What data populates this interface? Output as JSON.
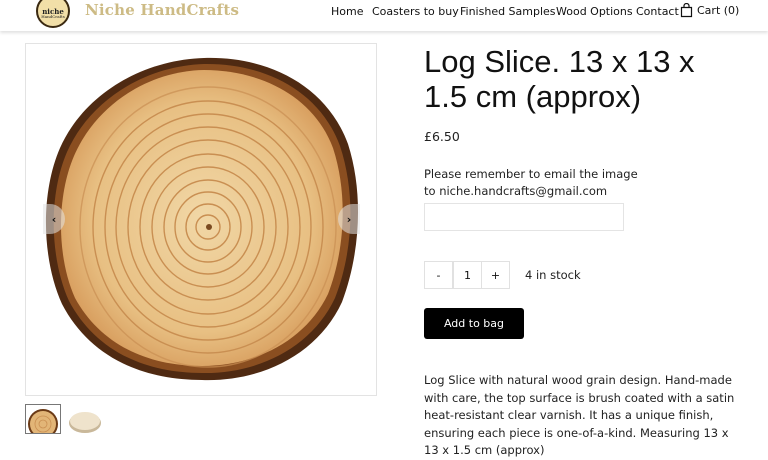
{
  "header": {
    "logo_line1": "niche",
    "logo_line2": "HandCrafts",
    "brand": "Niche HandCrafts",
    "nav": [
      "Home",
      "Coasters to buy",
      "Finished Samples",
      "Wood Options",
      "Contact"
    ],
    "cart_label": "Cart",
    "cart_count": "(0)"
  },
  "product": {
    "title": "Log Slice. 13 x 13 x 1.5 cm (approx)",
    "price": "£6.50",
    "note": "Please remember to email the image to niche.handcrafts@gmail.com",
    "email_value": "",
    "qty_minus": "-",
    "qty_value": "1",
    "qty_plus": "+",
    "stock": "4 in stock",
    "add_to_bag": "Add to bag",
    "description": "Log Slice with natural wood grain design. Hand-made with care, the top surface is brush coated with a satin heat-resistant clear varnish. It has a unique finish, ensuring each piece is one-of-a-kind. Measuring 13 x 13 x 1.5 cm (approx)"
  },
  "gallery": {
    "prev_icon": "chevron-left",
    "next_icon": "chevron-right",
    "prev": "‹",
    "next": "›"
  },
  "colors": {
    "brand": "#cdbb85",
    "button": "#000000",
    "bark": "#5a3216",
    "wood": "#e9c389"
  }
}
